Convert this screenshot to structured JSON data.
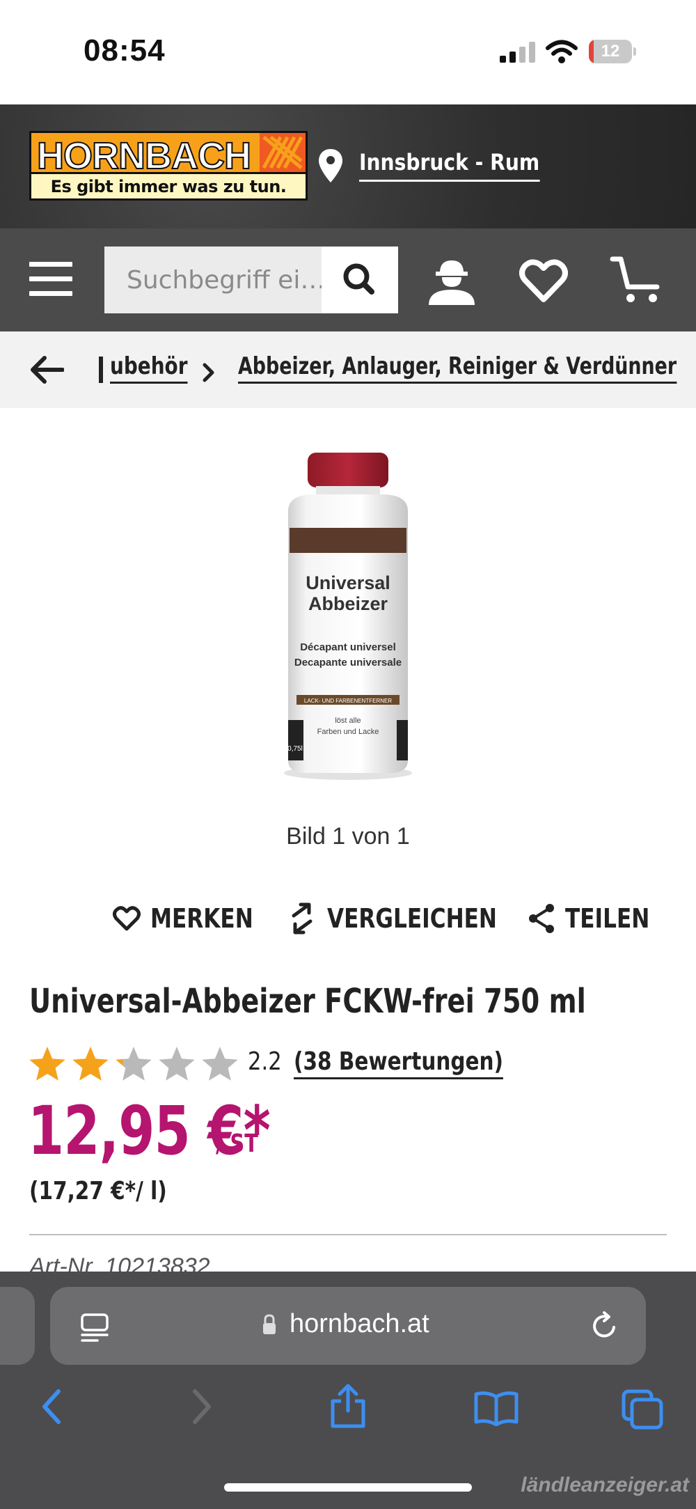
{
  "status_bar": {
    "time": "08:54",
    "battery": "12",
    "battery_level": 0.12
  },
  "header": {
    "logo_word": "HORNBACH",
    "logo_tagline": "Es gibt immer was zu tun.",
    "location": "Innsbruck - Rum"
  },
  "nav": {
    "search_placeholder": "Suchbegriff ei…",
    "icons": [
      "menu-icon",
      "search-icon",
      "user-icon",
      "heart-icon",
      "cart-icon"
    ]
  },
  "breadcrumb": {
    "items": [
      "ubehör",
      "Abbeizer, Anlauger, Reiniger & Verdünner"
    ]
  },
  "product": {
    "image_caption": "Bild 1 von 1",
    "bottle": {
      "line1": "Universal",
      "line2": "Abbeizer",
      "line3": "Décapant universel",
      "line4": "Decapante universale",
      "band": "LACK- UND FARBENENTFERNER",
      "line5": "löst alle",
      "line6": "Farben und Lacke",
      "volume": "0,75l"
    },
    "actions": {
      "merken": "MERKEN",
      "vergleichen": "VERGLEICHEN",
      "teilen": "TEILEN"
    },
    "title": "Universal-Abbeizer FCKW-frei 750 ml",
    "rating": "2.2",
    "rating_value": 2.2,
    "rating_max": 5,
    "reviews": "(38 Bewertungen)",
    "price": "12,95 €*",
    "price_unit": "/ ST",
    "unit_price": "(17,27 €*/ l)",
    "art_nr": "Art-Nr. 10213832"
  },
  "browser": {
    "url": "hornbach.at",
    "watermark": "ländleanzeiger.at"
  },
  "colors": {
    "brand_orange": "#f7a11a",
    "price_magenta": "#b5146f",
    "safari_blue": "#3d8ef0"
  }
}
